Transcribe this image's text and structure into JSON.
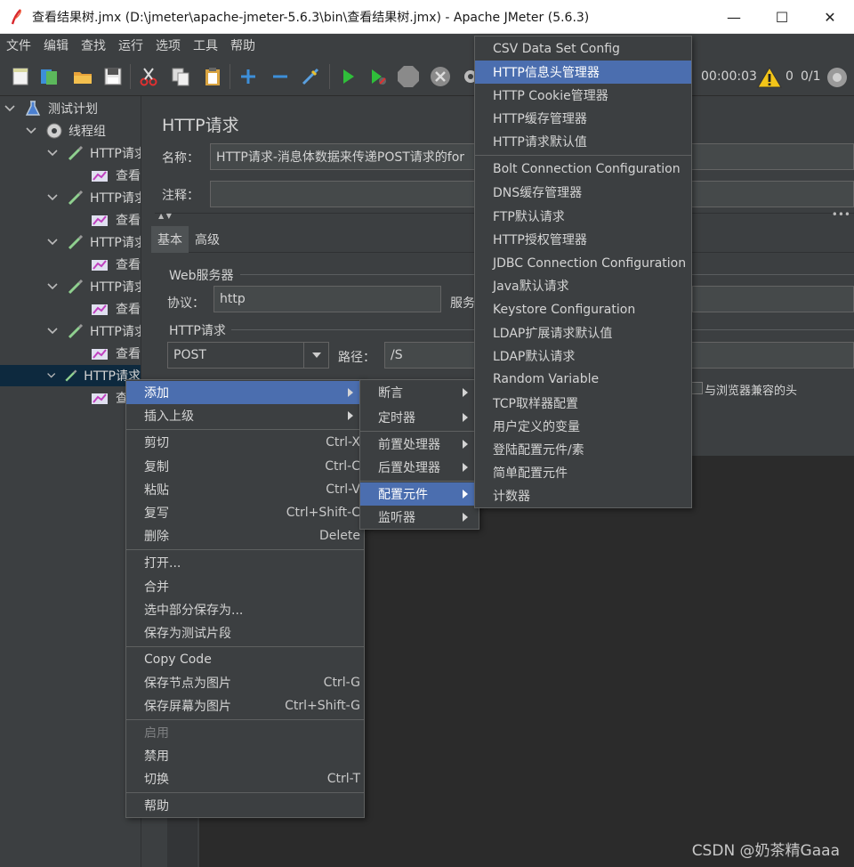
{
  "window": {
    "title": "查看结果树.jmx (D:\\jmeter\\apache-jmeter-5.6.3\\bin\\查看结果树.jmx) - Apache JMeter (5.6.3)",
    "minimize": "—",
    "maximize": "☐",
    "close": "✕"
  },
  "menubar": [
    "文件",
    "编辑",
    "查找",
    "运行",
    "选项",
    "工具",
    "帮助"
  ],
  "toolbar": {
    "timer": "00:00:03",
    "warnings": "0",
    "threads": "0/1"
  },
  "tree": {
    "root": "测试计划",
    "thread_group": "线程组",
    "http_label": "HTTP请求",
    "listener_label": "查看"
  },
  "panel": {
    "title": "HTTP请求",
    "name_label": "名称：",
    "name_value": "HTTP请求-消息体数据来传递POST请求的for",
    "comment_label": "注释：",
    "tabs": [
      "基本",
      "高级"
    ],
    "web_server": "Web服务器",
    "protocol_label": "协议：",
    "protocol_value": "http",
    "server_label": "服务",
    "http_request_group": "HTTP请求",
    "method": "POST",
    "path_label": "路径：",
    "path_value": "/S",
    "browser_compat": "与浏览器兼容的头"
  },
  "context_menu": {
    "items": [
      {
        "label": "添加",
        "submenu": true
      },
      {
        "label": "插入上级",
        "submenu": true
      },
      {
        "label": "剪切",
        "accel": "Ctrl-X"
      },
      {
        "label": "复制",
        "accel": "Ctrl-C"
      },
      {
        "label": "粘贴",
        "accel": "Ctrl-V"
      },
      {
        "label": "复写",
        "accel": "Ctrl+Shift-C"
      },
      {
        "label": "删除",
        "accel": "Delete"
      },
      {
        "label": "打开..."
      },
      {
        "label": "合并"
      },
      {
        "label": "选中部分保存为..."
      },
      {
        "label": "保存为测试片段"
      },
      {
        "label": "Copy Code"
      },
      {
        "label": "保存节点为图片",
        "accel": "Ctrl-G"
      },
      {
        "label": "保存屏幕为图片",
        "accel": "Ctrl+Shift-G"
      },
      {
        "label": "启用"
      },
      {
        "label": "禁用"
      },
      {
        "label": "切换",
        "accel": "Ctrl-T"
      },
      {
        "label": "帮助"
      }
    ]
  },
  "add_submenu": [
    "断言",
    "定时器",
    "前置处理器",
    "后置处理器",
    "配置元件",
    "监听器"
  ],
  "config_submenu": [
    "CSV Data Set Config",
    "HTTP信息头管理器",
    "HTTP Cookie管理器",
    "HTTP缓存管理器",
    "HTTP请求默认值",
    "Bolt Connection Configuration",
    "DNS缓存管理器",
    "FTP默认请求",
    "HTTP授权管理器",
    "JDBC Connection Configuration",
    "Java默认请求",
    "Keystore Configuration",
    "LDAP扩展请求默认值",
    "LDAP默认请求",
    "Random Variable",
    "TCP取样器配置",
    "用户定义的变量",
    "登陆配置元件/素",
    "简单配置元件",
    "计数器"
  ],
  "watermark": "CSDN @奶茶精Gaaa",
  "colors": {
    "bg": "#3c3f41",
    "highlight": "#4b6eaf",
    "selected_tree": "#0d293e",
    "run_green": "#2fbf3a"
  }
}
